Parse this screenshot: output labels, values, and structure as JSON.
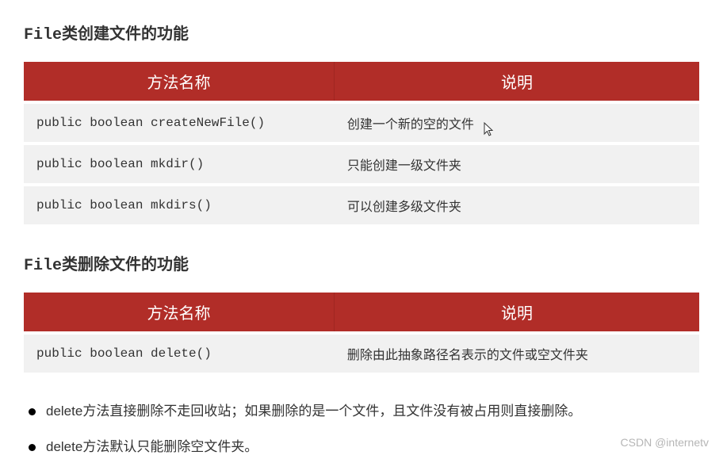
{
  "section1": {
    "title_prefix": "File",
    "title_rest": "类创建文件的功能",
    "headers": {
      "col1": "方法名称",
      "col2": "说明"
    },
    "rows": [
      {
        "method": "public boolean createNewFile()",
        "desc": "创建一个新的空的文件"
      },
      {
        "method": "public boolean mkdir()",
        "desc": "只能创建一级文件夹"
      },
      {
        "method": "public boolean mkdirs()",
        "desc": "可以创建多级文件夹"
      }
    ]
  },
  "section2": {
    "title_prefix": "File",
    "title_rest": "类删除文件的功能",
    "headers": {
      "col1": "方法名称",
      "col2": "说明"
    },
    "rows": [
      {
        "method": "public boolean delete()",
        "desc": "删除由此抽象路径名表示的文件或空文件夹"
      }
    ]
  },
  "notes": [
    "delete方法直接删除不走回收站；如果删除的是一个文件，且文件没有被占用则直接删除。",
    "delete方法默认只能删除空文件夹。"
  ],
  "watermark": "CSDN @internetv"
}
